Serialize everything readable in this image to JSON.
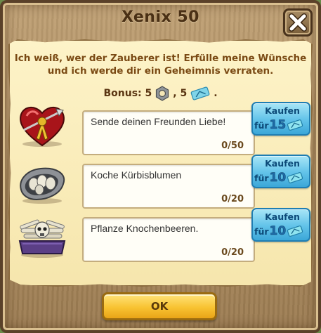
{
  "dialog": {
    "title": "Xenix 50",
    "intro": "Ich weiß, wer der Zauberer ist! Erfülle meine Wünsche und ich werde dir ein Geheimnis verraten.",
    "bonus": {
      "label": "Bonus: 5",
      "separator": ", 5",
      "end": ".",
      "icons": [
        "gear-nut-icon",
        "money-bill-icon"
      ]
    },
    "tasks": [
      {
        "text": "Sende deinen Freunden Liebe!",
        "progress": "0/50",
        "buy_label": "Kaufen",
        "buy_prefix": "für",
        "buy_price": "15",
        "icon": "heart-icon"
      },
      {
        "text": "Koche Kürbisblumen",
        "progress": "0/20",
        "buy_label": "Kaufen",
        "buy_prefix": "für",
        "buy_price": "10",
        "icon": "egg-nest-icon"
      },
      {
        "text": "Pflanze Knochenbeeren.",
        "progress": "0/20",
        "buy_label": "Kaufen",
        "buy_prefix": "für",
        "buy_price": "10",
        "icon": "bone-box-icon"
      }
    ],
    "ok_label": "OK",
    "colors": {
      "title": "#4a3015",
      "intro": "#7a4a14",
      "buy_button": "#66c5ea",
      "ok_button": "#f8c332"
    }
  }
}
